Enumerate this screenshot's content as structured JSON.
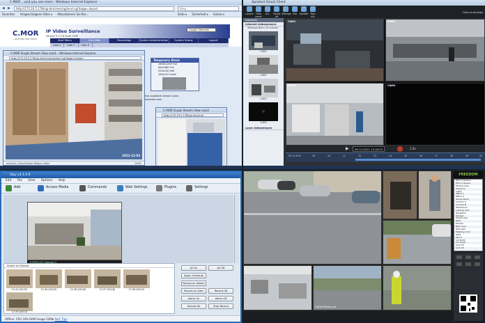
{
  "browser": {
    "title": "C-MOR ...and you see more - Windows Internet Explorer",
    "url": "http://172.20.5.178/cgi-bin/cmor/cgi/avcl.cgi?page=layout",
    "search_placeholder": "Bing",
    "favorites": [
      "Favoriten",
      "Vorgeschlagene Sites ▾",
      "Aktualisieren Sie Bro..."
    ],
    "tools": [
      "Seite ▾",
      "Sicherheit ▾",
      "Extras ▾"
    ],
    "logo": "C.MOR",
    "logo_tag": "...and you see more",
    "header_title": "IP Video Surveillance",
    "version": "Version 5.7.0.6 Build 1999",
    "language": "Google Übersetz",
    "nav": [
      "Start Menu",
      "Live-View",
      "Recordings",
      "System Administration",
      "System Status",
      "Logout"
    ],
    "nav_active": 1,
    "subnav": [
      "Cam 1",
      "Cam 2",
      "Cam 3"
    ],
    "stream_title": "C-MOR Single Stream View cam1 - Windows Internet Explorer",
    "stream_url": "http://172.20.5.178/cgi-bin/cmor/cgi/avcl.cgi?page=stream",
    "stream_status": "Internet | Geschützter Modus: Aktiv",
    "zoom": "100%",
    "stream_overlay": "2011-12-03",
    "temp_title": "Temporary Stock",
    "temp_items": [
      "1600x1200 Full",
      "640x480 Full",
      "320x240 Half",
      "160x120 Small"
    ],
    "note": [
      "the available stream sizes",
      "selected size."
    ],
    "stream2_title": "C-MOR Single Stream View cam2",
    "stream2_url": "http://172.20.5.178/cgi-bin/cmor"
  },
  "vms": {
    "title": "Xprotect Smart Client",
    "toolbar": [
      "Layout",
      "Hide panel",
      "ALL",
      "Sound off",
      "Settings",
      "Info",
      "Update",
      "Sign out"
    ],
    "toolbar_right": "Close all windows",
    "cameras_header": "Cameras",
    "section": "Internet videosensors",
    "tree_item": "Testhaus Bonn 1K scanner",
    "thumbs": [
      "CAM1",
      "CAM2",
      "CAM3",
      "CAM4"
    ],
    "local_section": "Local videosensors",
    "cam_labels": [
      "CAM1",
      "CAM2",
      "CAM3",
      "CAM4"
    ],
    "timestamp": "09.12.2012 13:16:33",
    "speed": "1.0x",
    "date": "09.12.2012",
    "timeline": [
      "09",
      "10",
      "11",
      "12",
      "13",
      "14",
      "15",
      "16",
      "17",
      "18",
      "19",
      "20"
    ]
  },
  "ispy": {
    "title": "iSpy v4.1.0.0",
    "menu": [
      "Edit",
      "File",
      "View",
      "Options",
      "Help"
    ],
    "toolbar": [
      "Add",
      "Access Media",
      "Commands",
      "Web Settings",
      "Plugins",
      "Settings"
    ],
    "cam_caption": "0 FPS 0.51 Camera 0",
    "list_header": "Select All Delete",
    "thumbs": [
      "12.41 (00:25)",
      "12.40 (00:25)",
      "12.38 (00:16)",
      "12.37 (00:16)",
      "12.36 (00:15)",
      "12.35 (00:14)"
    ],
    "buttons": [
      "All On",
      "All Off",
      "Apply Schedule",
      "Record on Detect",
      "Record on Alert",
      "Record Off",
      "Alerts On",
      "Alerts Off",
      "Record All",
      "Stop Record"
    ],
    "status": "Offline: CPU 16% RAM Usage 52Mb",
    "status_link": "Perf. Tips"
  },
  "wall": {
    "logo": "FREEDOM",
    "list": [
      "PTZ 1 Camera",
      "PTZ 2 Camera",
      "Parking area",
      "Entrance",
      "Lobby",
      "Office 1",
      "Office 2",
      "Server Room",
      "Corridor A",
      "Corridor B",
      "Warehouse",
      "Loading dock",
      "Reception",
      "Garage",
      "Street view",
      "Roof",
      "Kitchen",
      "Back door",
      "Stair well",
      "Meeting room",
      "Gate",
      "Fence",
      "Lot North",
      "Lot South",
      "Cam 25",
      "Cam 26"
    ],
    "overlay": "CW16 Parking lot"
  }
}
